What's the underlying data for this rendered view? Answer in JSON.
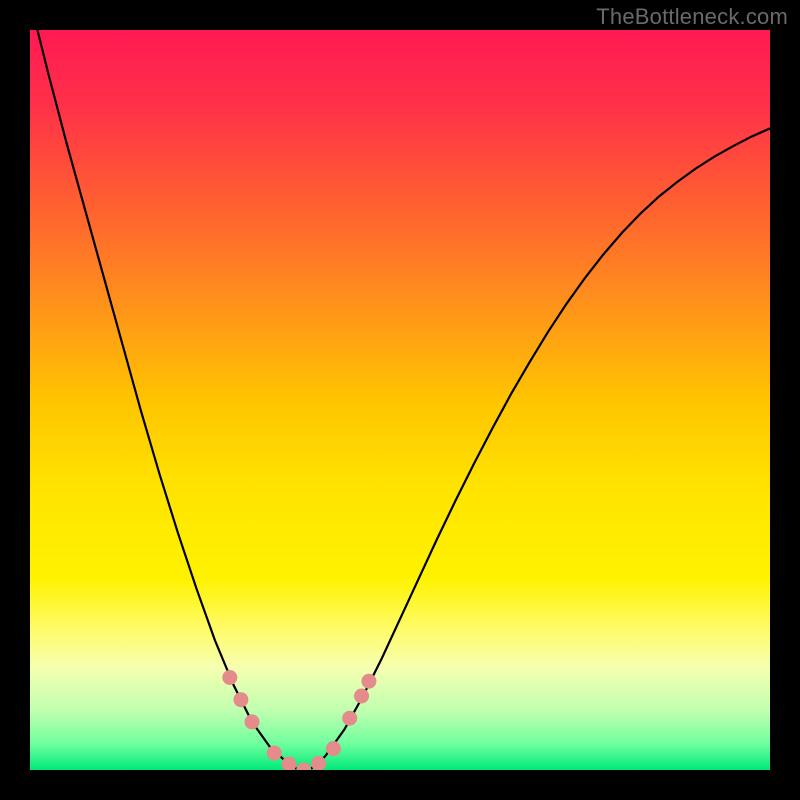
{
  "watermark": "TheBottleneck.com",
  "chart_data": {
    "type": "line",
    "title": "",
    "xlabel": "",
    "ylabel": "",
    "xlim": [
      0,
      100
    ],
    "ylim": [
      0,
      100
    ],
    "grid": false,
    "legend": false,
    "series": [
      {
        "name": "curve",
        "color": "#000000",
        "x": [
          0.0,
          2.5,
          5.0,
          7.5,
          10.0,
          12.5,
          15.0,
          17.5,
          20.0,
          22.5,
          25.0,
          27.5,
          30.0,
          32.5,
          35.0,
          36.0,
          37.0,
          38.0,
          39.0,
          40.0,
          42.5,
          45.0,
          47.5,
          50.0,
          52.5,
          55.0,
          57.5,
          60.0,
          62.5,
          65.0,
          67.5,
          70.0,
          72.5,
          75.0,
          77.5,
          80.0,
          82.5,
          85.0,
          87.5,
          90.0,
          92.5,
          95.0,
          97.5,
          100.0
        ],
        "y": [
          104.0,
          94.0,
          84.5,
          75.5,
          66.5,
          57.5,
          48.5,
          40.0,
          32.0,
          24.5,
          17.5,
          11.5,
          6.5,
          3.0,
          0.8,
          0.2,
          0.0,
          0.2,
          0.9,
          2.0,
          5.5,
          10.0,
          15.0,
          20.4,
          25.8,
          31.2,
          36.4,
          41.4,
          46.2,
          50.8,
          55.1,
          59.2,
          63.0,
          66.5,
          69.7,
          72.6,
          75.2,
          77.5,
          79.5,
          81.3,
          82.9,
          84.3,
          85.6,
          86.7
        ]
      }
    ],
    "markers": {
      "name": "threshold-markers",
      "color": "#e58b8b",
      "x": [
        27.0,
        28.5,
        30.0,
        33.0,
        35.0,
        37.0,
        39.0,
        41.0,
        43.2,
        44.8,
        45.8
      ],
      "y": [
        12.5,
        9.5,
        6.5,
        2.3,
        0.8,
        0.0,
        0.9,
        2.9,
        7.0,
        10.0,
        12.0
      ]
    },
    "gradient_stops": [
      {
        "offset": 0.0,
        "color": "#ff1a53"
      },
      {
        "offset": 0.1,
        "color": "#ff3049"
      },
      {
        "offset": 0.22,
        "color": "#ff5a33"
      },
      {
        "offset": 0.35,
        "color": "#ff8a1f"
      },
      {
        "offset": 0.5,
        "color": "#ffc400"
      },
      {
        "offset": 0.62,
        "color": "#ffe400"
      },
      {
        "offset": 0.74,
        "color": "#fff200"
      },
      {
        "offset": 0.8,
        "color": "#fffa5a"
      },
      {
        "offset": 0.86,
        "color": "#f7ffb0"
      },
      {
        "offset": 0.92,
        "color": "#c0ffb0"
      },
      {
        "offset": 0.965,
        "color": "#6fff9e"
      },
      {
        "offset": 1.0,
        "color": "#00e97a"
      }
    ]
  }
}
